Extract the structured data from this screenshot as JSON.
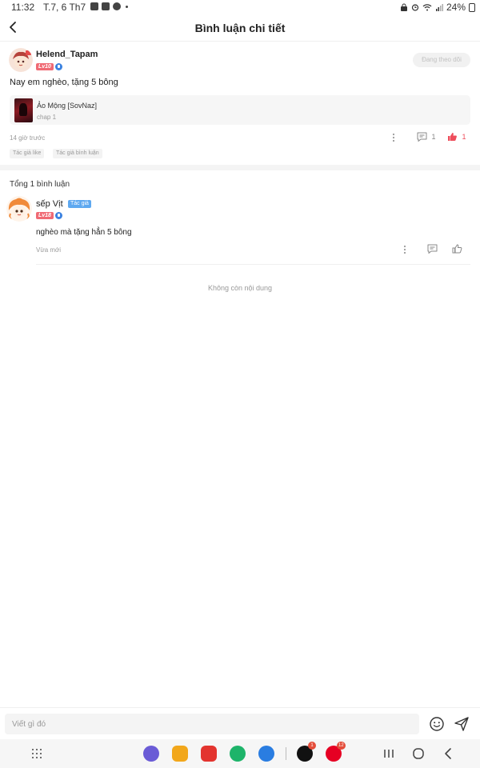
{
  "status_bar": {
    "time": "11:32",
    "date": "T.7, 6 Th7",
    "battery": "24%"
  },
  "header": {
    "title": "Bình luận chi tiết"
  },
  "main_comment": {
    "username": "Helend_Tapam",
    "level": "Lv10",
    "follow_label": "Đang theo dõi",
    "text": "Nay em nghèo, tặng 5 bông",
    "book": {
      "title": "Ảo Mộng [SovNaz]",
      "chapter": "chap 1"
    },
    "time": "14 giờ trước",
    "comment_count": "1",
    "like_count": "1",
    "tags": [
      "Tác giả like",
      "Tác giả bình luận"
    ]
  },
  "replies_header": "Tổng 1 bình luận",
  "reply": {
    "username": "sếp Vịt",
    "author_badge": "Tác giả",
    "level": "Lv18",
    "text": "nghèo mà tặng hẳn 5 bông",
    "time": "Vừa mới"
  },
  "no_more": "Không còn nội dung",
  "input": {
    "placeholder": "Viết gì đó"
  },
  "nav": {
    "tiktok_badge": "1",
    "pinterest_badge": "12"
  },
  "colors": {
    "like_active": "#ee4d5b",
    "level_badge": "#f06a74",
    "author_badge": "#5ea8f0"
  }
}
